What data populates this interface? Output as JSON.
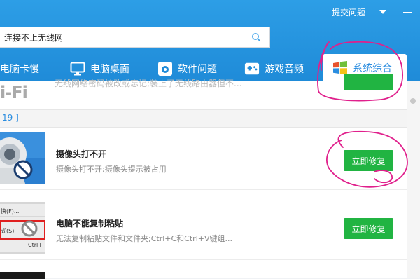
{
  "header": {
    "submit_label": "提交问题",
    "accent": "#2a8de0",
    "icons": [
      "dropdown-triangle-icon",
      "minimize-icon"
    ]
  },
  "search": {
    "value": "连接不上无线网",
    "icon": "search-icon"
  },
  "tabs": [
    {
      "label": "电脑卡慢",
      "icon": "none",
      "active": false
    },
    {
      "label": "电脑桌面",
      "icon": "monitor-icon",
      "active": false
    },
    {
      "label": "软件问题",
      "icon": "software-icon",
      "active": false
    },
    {
      "label": "游戏音频",
      "icon": "gamepad-icon",
      "active": false
    },
    {
      "label": "系统综合",
      "icon": "windows-logo-icon",
      "active": true
    }
  ],
  "partial_item": {
    "thumb_text": "i-Fi",
    "desc": "无线网络密码被改或忘记;装上了无线路由器但不..."
  },
  "section": {
    "label": "19 ]"
  },
  "items": [
    {
      "title": "摄像头打不开",
      "desc": "摄像头打不开;摄像头提示被占用",
      "button": "立即修复",
      "icon": "webcam-blocked-icon"
    },
    {
      "title": "电脑不能复制粘贴",
      "desc": "无法复制粘贴文件和文件夹;Ctrl+C和Ctrl+V键组...",
      "button": "立即修复",
      "icon": "copy-paste-blocked-icon",
      "thumb_lines": [
        "快(F)...",
        "式(S)",
        "Ctrl+"
      ]
    }
  ],
  "colors": {
    "header_blue": "#1f8bd8",
    "fix_green": "#21b442",
    "annotation_magenta": "#e0208c"
  }
}
